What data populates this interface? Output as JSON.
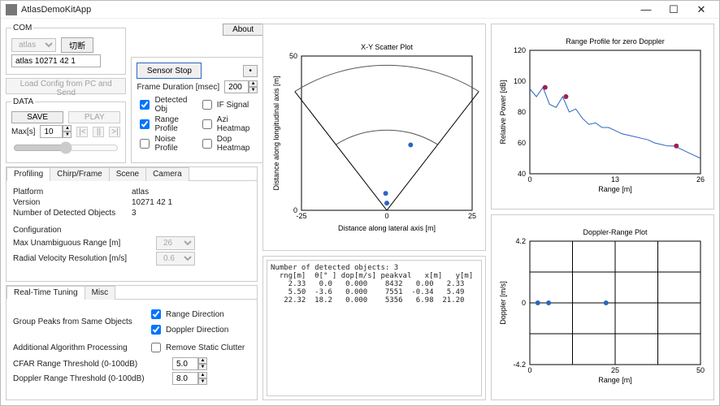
{
  "window": {
    "title": "AtlasDemoKitApp"
  },
  "com": {
    "legend": "COM",
    "port_select": "atlas",
    "scan_button": "切断",
    "device": "atlas 10271 42 1",
    "load_config": "Load Config from PC and Send"
  },
  "data": {
    "legend": "DATA",
    "save": "SAVE",
    "play": "PLAY",
    "maxs_label": "Max[s]",
    "maxs_value": "10"
  },
  "sensor": {
    "button": "Sensor Stop",
    "dot_button": "•",
    "about": "About",
    "frame_label": "Frame Duration [msec]",
    "frame_value": "200",
    "checks": {
      "detected": "Detected Obj",
      "ifsignal": "IF Signal",
      "rangeprofile": "Range Profile",
      "aziheatmap": "Azi Heatmap",
      "noiseprofile": "Noise Profile",
      "dopheatmap": "Dop Heatmap"
    }
  },
  "tabs": {
    "profiling": "Profiling",
    "chirp": "Chirp/Frame",
    "scene": "Scene",
    "camera": "Camera"
  },
  "profiling": {
    "platform_label": "Platform",
    "platform_value": "atlas",
    "version_label": "Version",
    "version_value": "10271 42 1",
    "ndet_label": "Number of Detected Objects",
    "ndet_value": "3",
    "config_label": "Configuration",
    "maxunamb_label": "Max Unambiguous Range [m]",
    "maxunamb_value": "26",
    "radvel_label": "Radial Velocity Resolution [m/s]",
    "radvel_value": "0.6"
  },
  "tuning_tabs": {
    "rt": "Real-Time Tuning",
    "misc": "Misc"
  },
  "tuning": {
    "group_label": "Group Peaks from Same Objects",
    "range_dir": "Range Direction",
    "doppler_dir": "Doppler Direction",
    "addl_label": "Additional Algorithm Processing",
    "remove_static": "Remove Static Clutter",
    "cfar_label": "CFAR Range Threshold (0-100dB)",
    "cfar_value": "5.0",
    "doppler_label": "Doppler Range Threshold (0-100dB)",
    "doppler_value": "8.0"
  },
  "console": {
    "text": "Number of detected objects: 3\n  rng[m]  θ[° ] dop[m/s] peakval   x[m]   y[m]\n    2.33   0.0   0.000    8432   0.00   2.33\n    5.50  -3.6   0.000    7551  -0.34   5.49\n   22.32  18.2   0.000    5356   6.98  21.20"
  },
  "charts": {
    "xy": {
      "title": "X-Y Scatter Plot",
      "xlabel": "Distance along lateral axis [m]",
      "ylabel": "Distance along longitudinal axis [m]"
    },
    "range": {
      "title": "Range Profile for zero Doppler",
      "xlabel": "Range [m]",
      "ylabel": "Relative Power [dB]"
    },
    "doppler": {
      "title": "Doppler-Range Plot",
      "xlabel": "Range [m]",
      "ylabel": "Doppler [m/s]"
    }
  },
  "chart_data": [
    {
      "name": "xy_scatter",
      "type": "scatter",
      "title": "X-Y Scatter Plot",
      "xlabel": "Distance along lateral axis [m]",
      "ylabel": "Distance along longitudinal axis [m]",
      "xlim": [
        -25,
        25
      ],
      "ylim": [
        0,
        50
      ],
      "sector_arcs": [
        26,
        47
      ],
      "sector_angle_deg": [
        -35,
        35
      ],
      "points": [
        {
          "x": 0.0,
          "y": 2.33
        },
        {
          "x": -0.34,
          "y": 5.49
        },
        {
          "x": 6.98,
          "y": 21.2
        }
      ]
    },
    {
      "name": "range_profile",
      "type": "line",
      "title": "Range Profile for zero Doppler",
      "xlabel": "Range [m]",
      "ylabel": "Relative Power [dB]",
      "xlim": [
        0,
        26
      ],
      "ylim": [
        40,
        120
      ],
      "xticks": [
        0,
        13,
        26
      ],
      "yticks": [
        40,
        60,
        80,
        100,
        120
      ],
      "series": [
        {
          "name": "power",
          "x": [
            0,
            1,
            2,
            3,
            4,
            5,
            6,
            7,
            8,
            9,
            10,
            11,
            12,
            13,
            14,
            15,
            16,
            17,
            18,
            19,
            20,
            21,
            22,
            23,
            24,
            25,
            26
          ],
          "y": [
            95,
            90,
            96,
            85,
            83,
            90,
            80,
            82,
            76,
            72,
            73,
            70,
            70,
            68,
            66,
            65,
            64,
            63,
            62,
            60,
            59,
            58,
            58,
            56,
            54,
            52,
            50
          ]
        }
      ],
      "markers": [
        {
          "x": 2.33,
          "y": 96
        },
        {
          "x": 5.5,
          "y": 90
        },
        {
          "x": 22.32,
          "y": 58
        }
      ]
    },
    {
      "name": "doppler_range",
      "type": "scatter",
      "title": "Doppler-Range Plot",
      "xlabel": "Range [m]",
      "ylabel": "Doppler [m/s]",
      "xlim": [
        0,
        50
      ],
      "ylim": [
        -4.2,
        4.2
      ],
      "xticks": [
        0,
        25,
        50
      ],
      "yticks": [
        -4.2,
        0,
        4.2
      ],
      "points": [
        {
          "x": 2.33,
          "y": 0.0
        },
        {
          "x": 5.5,
          "y": 0.0
        },
        {
          "x": 22.32,
          "y": 0.0
        }
      ]
    },
    {
      "name": "detected_objects_table",
      "type": "table",
      "columns": [
        "rng[m]",
        "θ[°]",
        "dop[m/s]",
        "peakval",
        "x[m]",
        "y[m]"
      ],
      "rows": [
        [
          2.33,
          0.0,
          0.0,
          8432,
          0.0,
          2.33
        ],
        [
          5.5,
          -3.6,
          0.0,
          7551,
          -0.34,
          5.49
        ],
        [
          22.32,
          18.2,
          0.0,
          5356,
          6.98,
          21.2
        ]
      ]
    }
  ]
}
